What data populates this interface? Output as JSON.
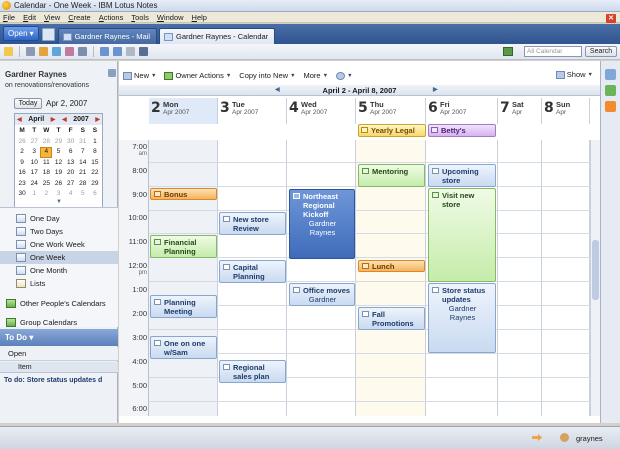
{
  "window": {
    "title": "Calendar - One Week - IBM Lotus Notes"
  },
  "menu": [
    "File",
    "Edit",
    "View",
    "Create",
    "Actions",
    "Tools",
    "Window",
    "Help"
  ],
  "tabs": {
    "open": "Open",
    "mail": "Gardner Raynes - Mail",
    "calendar": "Gardner Raynes - Calendar"
  },
  "search": {
    "placeholder": "All Calendar",
    "button": "Search"
  },
  "left": {
    "owner": "Gardner Raynes",
    "path": "on renovations/renovations",
    "today_button": "Today",
    "today_date": "Apr 2, 2007",
    "minical": {
      "month": "April",
      "year": "2007",
      "weekdays": [
        "M",
        "T",
        "W",
        "T",
        "F",
        "S",
        "S"
      ],
      "days": [
        [
          "26",
          "27",
          "28",
          "29",
          "30",
          "31",
          "1"
        ],
        [
          "2",
          "3",
          "4",
          "5",
          "6",
          "7",
          "8"
        ],
        [
          "9",
          "10",
          "11",
          "12",
          "13",
          "14",
          "15"
        ],
        [
          "16",
          "17",
          "18",
          "19",
          "20",
          "21",
          "22"
        ],
        [
          "23",
          "24",
          "25",
          "26",
          "27",
          "28",
          "29"
        ],
        [
          "30",
          "1",
          "2",
          "3",
          "4",
          "5",
          "6"
        ]
      ],
      "selected": "4"
    },
    "views": [
      "One Day",
      "Two Days",
      "One Work Week",
      "One Week",
      "One Month",
      "Lists"
    ],
    "selected_view": "One Week",
    "groups": [
      "Other People's Calendars",
      "Group Calendars"
    ],
    "todo": {
      "title": "To Do",
      "open": "Open",
      "column": "Item",
      "row": "To do: Store status updates d"
    }
  },
  "main": {
    "toolbar": {
      "new": "New",
      "owner_actions": "Owner Actions",
      "copy_into_new": "Copy into New",
      "more": "More",
      "show": "Show"
    },
    "range": "April 2 - April 8, 2007",
    "days": [
      {
        "num": "2",
        "name": "Mon",
        "mon": "Apr 2007"
      },
      {
        "num": "3",
        "name": "Tue",
        "mon": "Apr 2007"
      },
      {
        "num": "4",
        "name": "Wed",
        "mon": "Apr 2007"
      },
      {
        "num": "5",
        "name": "Thu",
        "mon": "Apr 2007"
      },
      {
        "num": "6",
        "name": "Fri",
        "mon": "Apr 2007"
      },
      {
        "num": "7",
        "name": "Sat",
        "mon": "Apr"
      },
      {
        "num": "8",
        "name": "Sun",
        "mon": "Apr"
      }
    ],
    "times": [
      {
        "t": "7:00",
        "ampm": "am"
      },
      {
        "t": "8:00",
        "ampm": ""
      },
      {
        "t": "9:00",
        "ampm": ""
      },
      {
        "t": "10:00",
        "ampm": ""
      },
      {
        "t": "11:00",
        "ampm": ""
      },
      {
        "t": "12:00",
        "ampm": "pm"
      },
      {
        "t": "1:00",
        "ampm": ""
      },
      {
        "t": "2:00",
        "ampm": ""
      },
      {
        "t": "3:00",
        "ampm": ""
      },
      {
        "t": "4:00",
        "ampm": ""
      },
      {
        "t": "5:00",
        "ampm": ""
      },
      {
        "t": "6:00",
        "ampm": ""
      }
    ],
    "allday": {
      "yearly_legal": "Yearly Legal",
      "bettys": "Betty's"
    },
    "events": {
      "bonus": "Bonus",
      "financial": "Financial Planning",
      "planning": "Planning Meeting",
      "oneonone": "One on one w/Sam",
      "newstore": "New store Review",
      "capital": "Capital Planning",
      "regional": "Regional sales plan",
      "northeast": "Northeast Regional Kickoff",
      "northeast_who": "Gardner Raynes",
      "office": "Office moves",
      "office_who": "Gardner",
      "mentoring": "Mentoring",
      "lunch": "Lunch",
      "fall": "Fall Promotions",
      "upcoming": "Upcoming store",
      "visit": "Visit new store",
      "status": "Store status updates",
      "status_who": "Gardner Raynes"
    }
  },
  "status": {
    "user": "graynes"
  }
}
